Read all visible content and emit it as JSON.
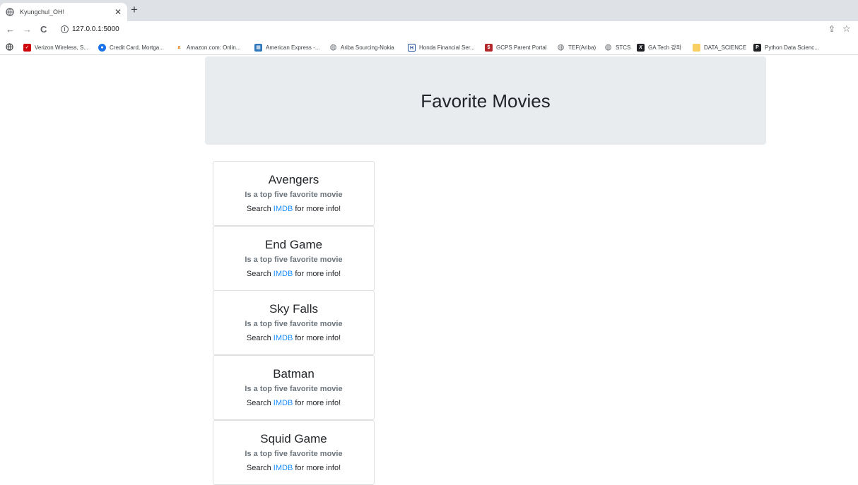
{
  "browser": {
    "tab_title": "Kyungchul_OH!",
    "tab_close": "✕",
    "new_tab": "+",
    "back": "←",
    "forward": "→",
    "reload": "C",
    "url": "127.0.0.1:5000",
    "share": "⇪",
    "star": "☆"
  },
  "bookmarks": [
    {
      "label": "Verizon Wireless, S...",
      "color": "#cd040b",
      "glyph": "✓"
    },
    {
      "label": "Credit Card, Mortga...",
      "color": "#1a73e8",
      "glyph": "●"
    },
    {
      "label": "Amazon.com: Onlin...",
      "color": "#ffffff",
      "glyph": "a"
    },
    {
      "label": "American Express -...",
      "color": "#2e77bb",
      "glyph": "▦"
    },
    {
      "label": "Ariba Sourcing-Nokia",
      "color": "#5f6368",
      "glyph": "◍"
    },
    {
      "label": "Honda Financial Ser...",
      "color": "#1f4e9c",
      "glyph": "H"
    },
    {
      "label": "GCPS Parent Portal",
      "color": "#b3262b",
      "glyph": "$"
    },
    {
      "label": "TEF(Ariba)",
      "color": "#5f6368",
      "glyph": "◍"
    },
    {
      "label": "STCS",
      "color": "#5f6368",
      "glyph": "◍"
    },
    {
      "label": "GA Tech 강좌",
      "color": "#202124",
      "glyph": "X"
    },
    {
      "label": "DATA_SCIENCE",
      "color": "#f9cf63",
      "glyph": ""
    },
    {
      "label": "Python Data Scienc...",
      "color": "#202124",
      "glyph": "P"
    }
  ],
  "page": {
    "heading": "Favorite Movies"
  },
  "movies": [
    {
      "title": "Avengers",
      "subtitle": "Is a top five favorite movie",
      "search_pre": "Search ",
      "link": "IMDB",
      "search_post": " for more info!"
    },
    {
      "title": "End Game",
      "subtitle": "Is a top five favorite movie",
      "search_pre": "Search ",
      "link": "IMDB",
      "search_post": " for more info!"
    },
    {
      "title": "Sky Falls",
      "subtitle": "Is a top five favorite movie",
      "search_pre": "Search ",
      "link": "IMDB",
      "search_post": " for more info!"
    },
    {
      "title": "Batman",
      "subtitle": "Is a top five favorite movie",
      "search_pre": "Search ",
      "link": "IMDB",
      "search_post": " for more info!"
    },
    {
      "title": "Squid Game",
      "subtitle": "Is a top five favorite movie",
      "search_pre": "Search ",
      "link": "IMDB",
      "search_post": " for more info!"
    }
  ]
}
